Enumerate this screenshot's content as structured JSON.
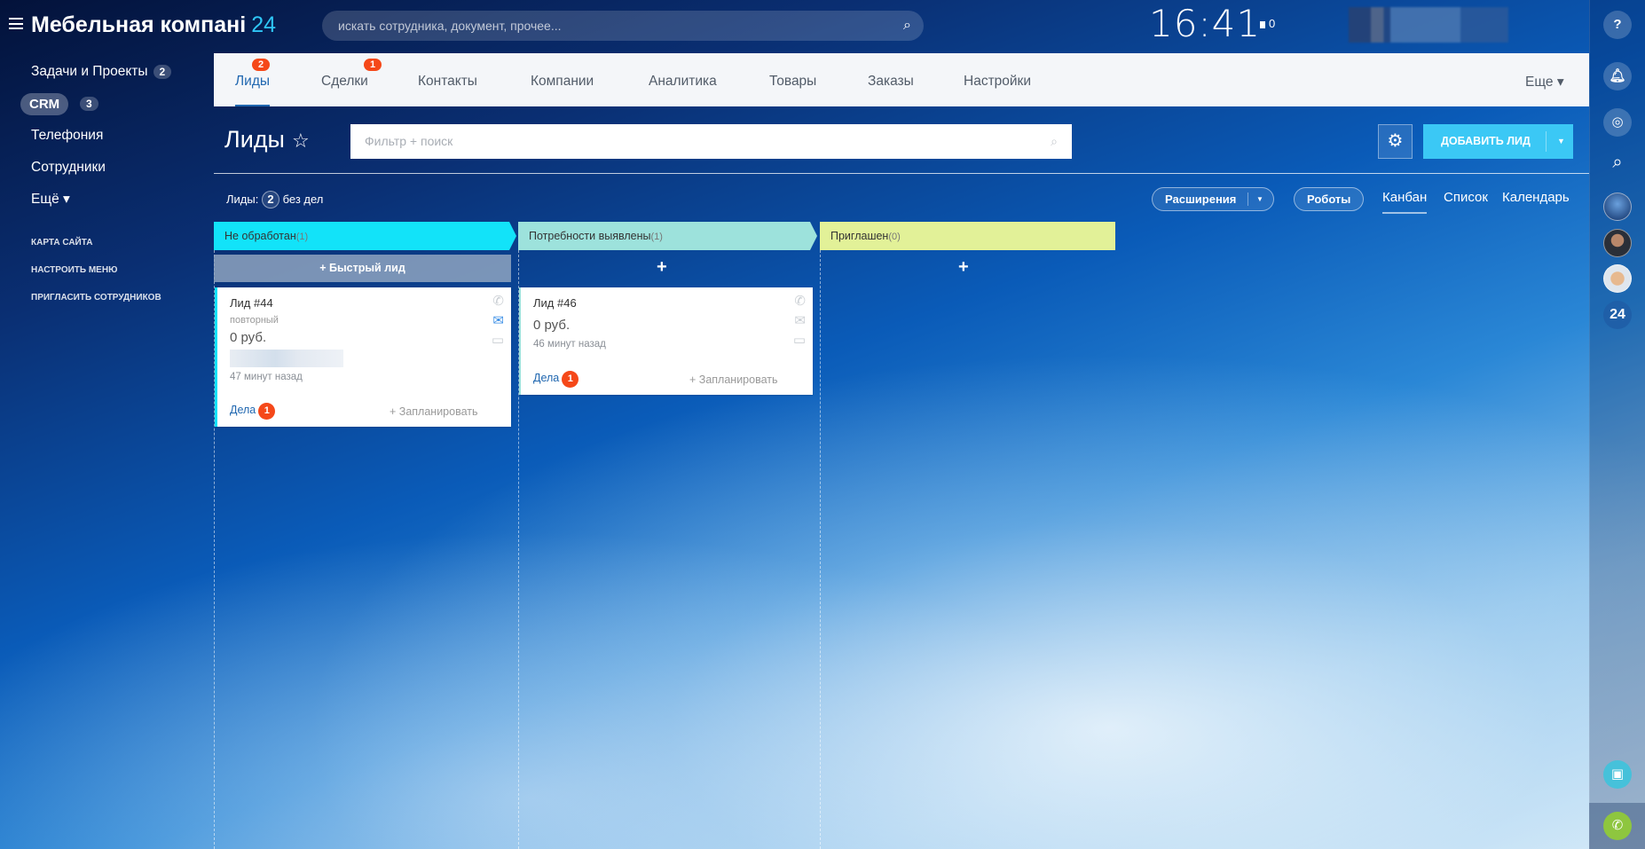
{
  "header": {
    "logo_name": "Мебельная компані",
    "logo_num": "24",
    "search_placeholder": "искать сотрудника, документ, прочее...",
    "clock": "16:41",
    "flag_count": "0"
  },
  "sidebar": {
    "items": [
      {
        "label": "Задачи и Проекты",
        "count": "2"
      },
      {
        "label": "CRM",
        "count": "3"
      },
      {
        "label": "Телефония"
      },
      {
        "label": "Сотрудники"
      },
      {
        "label": "Ещё ▾"
      }
    ],
    "links": [
      "КАРТА САЙТА",
      "НАСТРОИТЬ МЕНЮ",
      "ПРИГЛАСИТЬ СОТРУДНИКОВ"
    ]
  },
  "tabs": [
    {
      "label": "Лиды",
      "badge": "2"
    },
    {
      "label": "Сделки",
      "badge": "1"
    },
    {
      "label": "Контакты"
    },
    {
      "label": "Компании"
    },
    {
      "label": "Аналитика"
    },
    {
      "label": "Товары"
    },
    {
      "label": "Заказы"
    },
    {
      "label": "Настройки"
    }
  ],
  "tabs_more": "Еще ▾",
  "page": {
    "title": "Лиды",
    "filter_placeholder": "Фильтр + поиск",
    "add_button": "ДОБАВИТЬ ЛИД",
    "counter_label": "Лиды:",
    "counter_value": "2",
    "counter_suffix": "без дел",
    "extensions": "Расширения",
    "robots": "Роботы",
    "views": [
      "Канбан",
      "Список",
      "Календарь"
    ]
  },
  "kanban": {
    "quick_lead": "+ Быстрый лид",
    "plus": "+",
    "columns": [
      {
        "title": "Не обработан",
        "count": "(1)",
        "color": "#12e3f9"
      },
      {
        "title": "Потребности выявлены",
        "count": "(1)",
        "color": "#9de2dc"
      },
      {
        "title": "Приглашен",
        "count": "(0)",
        "color": "#e2f198"
      }
    ],
    "cards": [
      {
        "title": "Лид #44",
        "subtitle": "повторный",
        "amount": "0 руб.",
        "time": "47 минут назад",
        "tasks_label": "Дела",
        "tasks_count": "1",
        "plan": "+ Запланировать"
      },
      {
        "title": "Лид #46",
        "amount": "0 руб.",
        "time": "46 минут назад",
        "tasks_label": "Дела",
        "tasks_count": "1",
        "plan": "+ Запланировать"
      }
    ]
  },
  "rightbar": {
    "avatar_24": "24"
  },
  "colors": {
    "accent": "#2fc6f6",
    "badge": "#f54819",
    "add_button": "#3bc8f5"
  }
}
